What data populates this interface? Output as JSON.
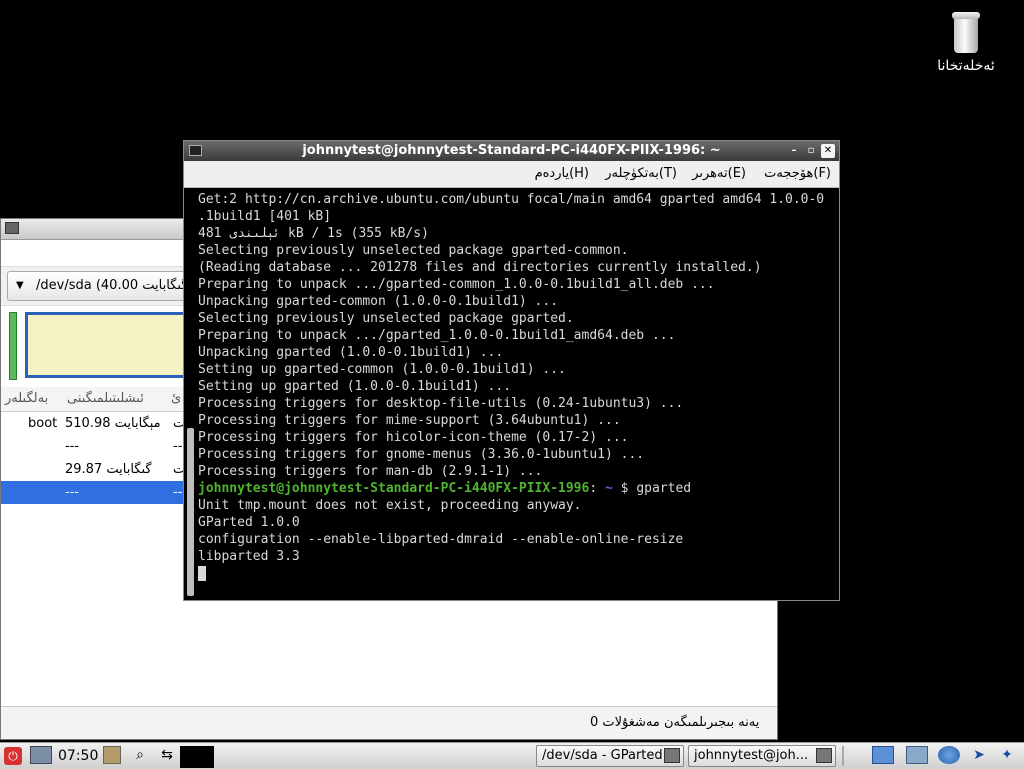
{
  "desktop": {
    "trash_label": "ئەخلەتخانا"
  },
  "gparted": {
    "device_combo": "/dev/sda  (40.00 گىگابايت)",
    "table": {
      "headers": [
        "بەلگىلەر",
        "ئىشلىتىلمىگىنى",
        "ئ"
      ],
      "rows": [
        {
          "flags": "boot",
          "unused": "510.98 مېگابايت",
          "extra": "ت",
          "selected": false
        },
        {
          "flags": "",
          "unused": "---",
          "extra": "--",
          "selected": false
        },
        {
          "flags": "",
          "unused": "29.87 گىگابايت",
          "extra": "ت",
          "selected": false
        },
        {
          "flags": "",
          "unused": "---",
          "extra": "--",
          "selected": true
        }
      ]
    },
    "status": "0 يەنە بىجىرىلمىگەن مەشغۇلات"
  },
  "terminal": {
    "title": "johnnytest@johnnytest-Standard-PC-i440FX-PIIX-1996: ~",
    "menu": [
      "ھۆججەت(F)",
      "تەھرىر(E)",
      "بەتكۈچلەر(T)",
      "ياردەم(H)"
    ],
    "lines": [
      "Get:2 http://cn.archive.ubuntu.com/ubuntu focal/main amd64 gparted amd64 1.0.0-0",
      ".1build1 [401 kB]",
      "481 ئېلىندى kB / 1s (355 kB/s)",
      "Selecting previously unselected package gparted-common.",
      "(Reading database ... 201278 files and directories currently installed.)",
      "Preparing to unpack .../gparted-common_1.0.0-0.1build1_all.deb ...",
      "Unpacking gparted-common (1.0.0-0.1build1) ...",
      "Selecting previously unselected package gparted.",
      "Preparing to unpack .../gparted_1.0.0-0.1build1_amd64.deb ...",
      "Unpacking gparted (1.0.0-0.1build1) ...",
      "Setting up gparted-common (1.0.0-0.1build1) ...",
      "Setting up gparted (1.0.0-0.1build1) ...",
      "Processing triggers for desktop-file-utils (0.24-1ubuntu3) ...",
      "Processing triggers for mime-support (3.64ubuntu1) ...",
      "Processing triggers for hicolor-icon-theme (0.17-2) ...",
      "Processing triggers for gnome-menus (3.36.0-1ubuntu1) ...",
      "Processing triggers for man-db (2.9.1-1) ..."
    ],
    "prompt_user": "johnnytest@johnnytest-Standard-PC-i440FX-PIIX-1996",
    "prompt_sep": ":",
    "prompt_path": "~",
    "prompt_symbol": "$",
    "command": "gparted",
    "output": [
      "Unit tmp.mount does not exist, proceeding anyway.",
      "GParted 1.0.0",
      "configuration --enable-libparted-dmraid --enable-online-resize",
      "libparted 3.3"
    ]
  },
  "taskbar": {
    "clock": "07:50",
    "tasks": [
      "/dev/sda - GParted",
      "johnnytest@joh..."
    ]
  }
}
